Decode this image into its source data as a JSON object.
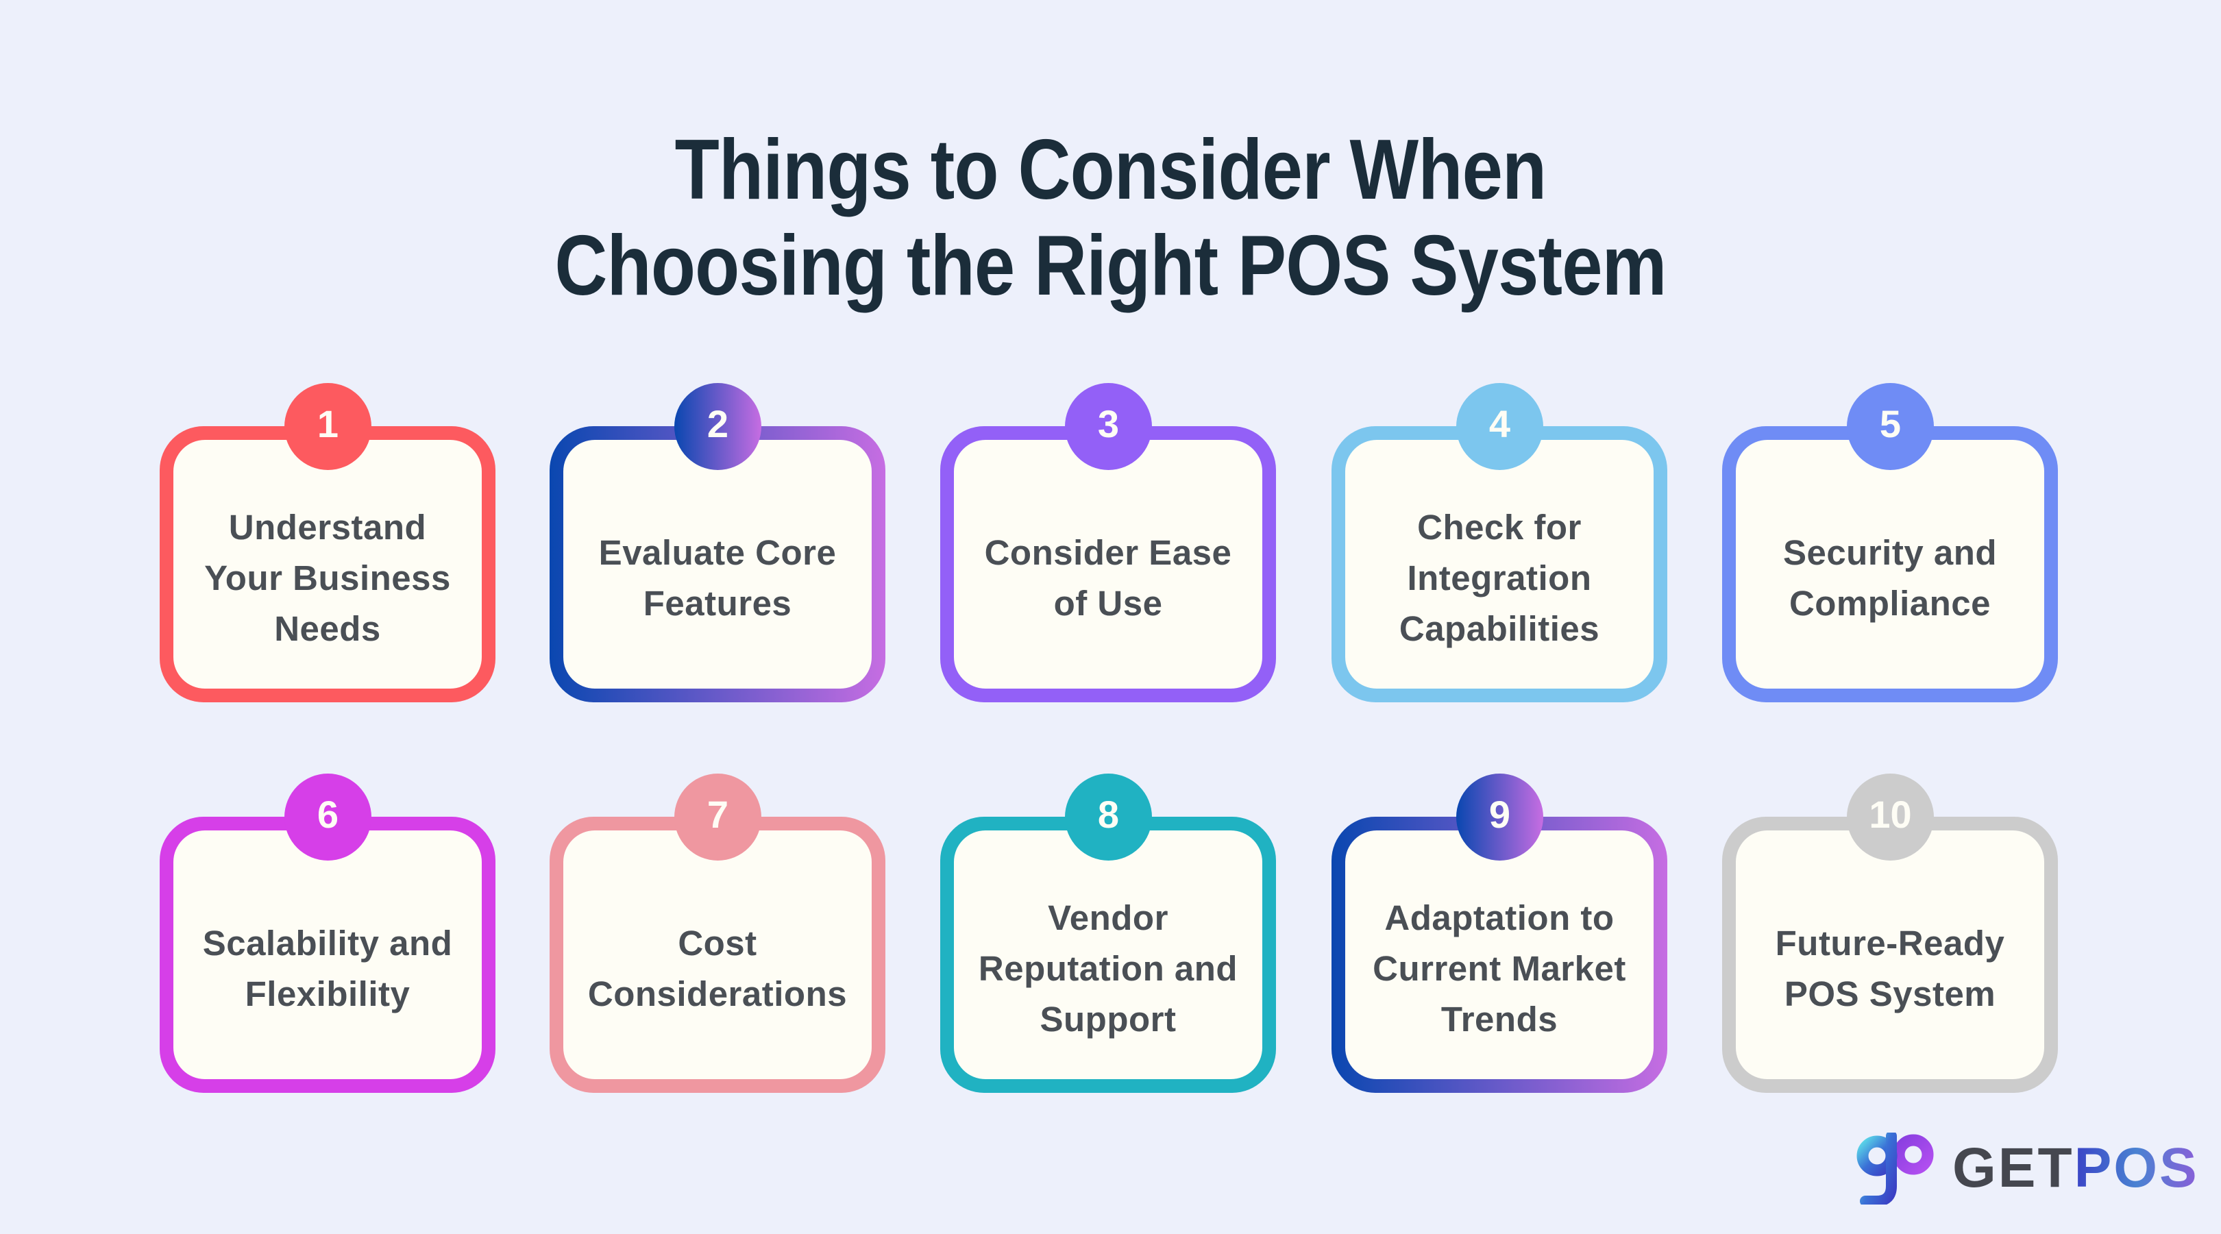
{
  "title": {
    "line1": "Things to Consider When",
    "line2": "Choosing the Right POS System"
  },
  "cards": [
    {
      "number": "1",
      "label": "Understand\nYour Business\nNeeds",
      "color": "#fd5a5f"
    },
    {
      "number": "2",
      "label": "Evaluate Core\nFeatures",
      "color_from": "#0a47b0",
      "color_to": "#c66de2"
    },
    {
      "number": "3",
      "label": "Consider Ease\nof Use",
      "color": "#9360f7"
    },
    {
      "number": "4",
      "label": "Check for\nIntegration\nCapabilities",
      "color": "#7cc6ee"
    },
    {
      "number": "5",
      "label": "Security and\nCompliance",
      "color": "#6f8cf5"
    },
    {
      "number": "6",
      "label": "Scalability and\nFlexibility",
      "color": "#d63fe8"
    },
    {
      "number": "7",
      "label": "Cost\nConsiderations",
      "color": "#ef97a0"
    },
    {
      "number": "8",
      "label": "Vendor\nReputation and\nSupport",
      "color": "#20b2c2"
    },
    {
      "number": "9",
      "label": "Adaptation to\nCurrent Market\nTrends",
      "color_from": "#0a47b0",
      "color_to": "#c66de2"
    },
    {
      "number": "10",
      "label": "Future-Ready\nPOS System",
      "color": "#cccccc"
    }
  ],
  "logo": {
    "icon": "gp-logo-icon",
    "word_part1": "GET",
    "word_part2": "POS"
  },
  "colors": {
    "background": "#edf0fb",
    "title": "#1b2d3a",
    "card_text": "#4a4f55",
    "card_fill": "#fefdf5"
  }
}
